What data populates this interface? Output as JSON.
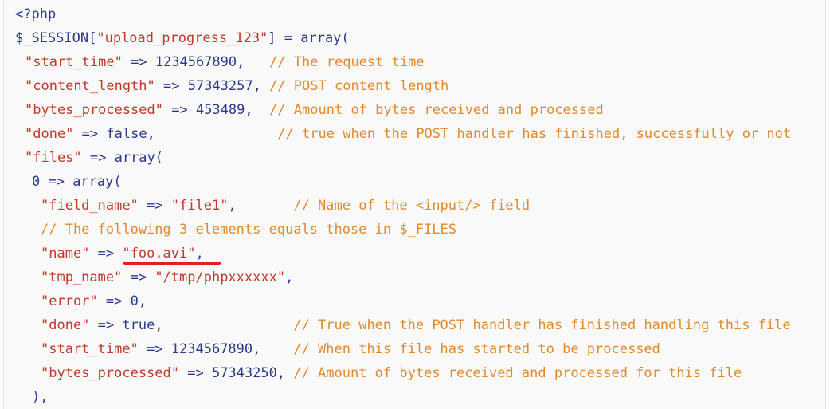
{
  "lines": [
    {
      "tokens": [
        {
          "c": "tag",
          "t": "<?php"
        }
      ]
    },
    {
      "tokens": [
        {
          "c": "kw",
          "t": "$_SESSION["
        },
        {
          "c": "str",
          "t": "\"upload_progress_123\""
        },
        {
          "c": "op",
          "t": "] = array("
        }
      ]
    },
    {
      "tokens": [
        {
          "c": "str",
          "t": "\"start_time\""
        },
        {
          "c": "op",
          "t": " => "
        },
        {
          "c": "num",
          "t": "1234567890"
        },
        {
          "c": "op",
          "t": ",   "
        },
        {
          "c": "cm",
          "t": "// The request time"
        }
      ]
    },
    {
      "tokens": [
        {
          "c": "str",
          "t": "\"content_length\""
        },
        {
          "c": "op",
          "t": " => "
        },
        {
          "c": "num",
          "t": "57343257"
        },
        {
          "c": "op",
          "t": ", "
        },
        {
          "c": "cm",
          "t": "// POST content length"
        }
      ]
    },
    {
      "tokens": [
        {
          "c": "str",
          "t": "\"bytes_processed\""
        },
        {
          "c": "op",
          "t": " => "
        },
        {
          "c": "num",
          "t": "453489"
        },
        {
          "c": "op",
          "t": ",  "
        },
        {
          "c": "cm",
          "t": "// Amount of bytes received and processed"
        }
      ]
    },
    {
      "tokens": [
        {
          "c": "str",
          "t": "\"done\""
        },
        {
          "c": "op",
          "t": " => "
        },
        {
          "c": "kw",
          "t": "false"
        },
        {
          "c": "op",
          "t": ",               "
        },
        {
          "c": "cm",
          "t": "// true when the POST handler has finished, successfully or not"
        }
      ]
    },
    {
      "tokens": [
        {
          "c": "str",
          "t": "\"files\""
        },
        {
          "c": "op",
          "t": " => array("
        }
      ]
    },
    {
      "tokens": [
        {
          "c": "num",
          "t": "0"
        },
        {
          "c": "op",
          "t": " => array("
        }
      ]
    },
    {
      "tokens": [
        {
          "c": "str",
          "t": "\"field_name\""
        },
        {
          "c": "op",
          "t": " => "
        },
        {
          "c": "str",
          "t": "\"file1\""
        },
        {
          "c": "op",
          "t": ",       "
        },
        {
          "c": "cm",
          "t": "// Name of the <input/> field"
        }
      ]
    },
    {
      "tokens": [
        {
          "c": "cm",
          "t": "// The following 3 elements equals those in $_FILES"
        }
      ]
    },
    {
      "tokens": [
        {
          "c": "str",
          "t": "\"name\""
        },
        {
          "c": "op",
          "t": " => "
        },
        {
          "c": "str",
          "t": "\"foo.avi\""
        },
        {
          "c": "op",
          "t": ","
        }
      ]
    },
    {
      "tokens": [
        {
          "c": "str",
          "t": "\"tmp_name\""
        },
        {
          "c": "op",
          "t": " => "
        },
        {
          "c": "str",
          "t": "\"/tmp/phpxxxxxx\""
        },
        {
          "c": "op",
          "t": ","
        }
      ]
    },
    {
      "tokens": [
        {
          "c": "str",
          "t": "\"error\""
        },
        {
          "c": "op",
          "t": " => "
        },
        {
          "c": "num",
          "t": "0"
        },
        {
          "c": "op",
          "t": ","
        }
      ]
    },
    {
      "tokens": [
        {
          "c": "str",
          "t": "\"done\""
        },
        {
          "c": "op",
          "t": " => "
        },
        {
          "c": "kw",
          "t": "true"
        },
        {
          "c": "op",
          "t": ",                "
        },
        {
          "c": "cm",
          "t": "// True when the POST handler has finished handling this file"
        }
      ]
    },
    {
      "tokens": [
        {
          "c": "str",
          "t": "\"start_time\""
        },
        {
          "c": "op",
          "t": " => "
        },
        {
          "c": "num",
          "t": "1234567890"
        },
        {
          "c": "op",
          "t": ",    "
        },
        {
          "c": "cm",
          "t": "// When this file has started to be processed"
        }
      ]
    },
    {
      "tokens": [
        {
          "c": "str",
          "t": "\"bytes_processed\""
        },
        {
          "c": "op",
          "t": " => "
        },
        {
          "c": "num",
          "t": "57343250"
        },
        {
          "c": "op",
          "t": ", "
        },
        {
          "c": "cm",
          "t": "// Amount of bytes received and processed for this file"
        }
      ]
    },
    {
      "tokens": [
        {
          "c": "op",
          "t": "),"
        }
      ]
    }
  ],
  "colors": {
    "string": "#c0392b",
    "keyword": "#2b3a8a",
    "comment": "#e28a2b",
    "highlight_underline": "#e01f1f"
  }
}
